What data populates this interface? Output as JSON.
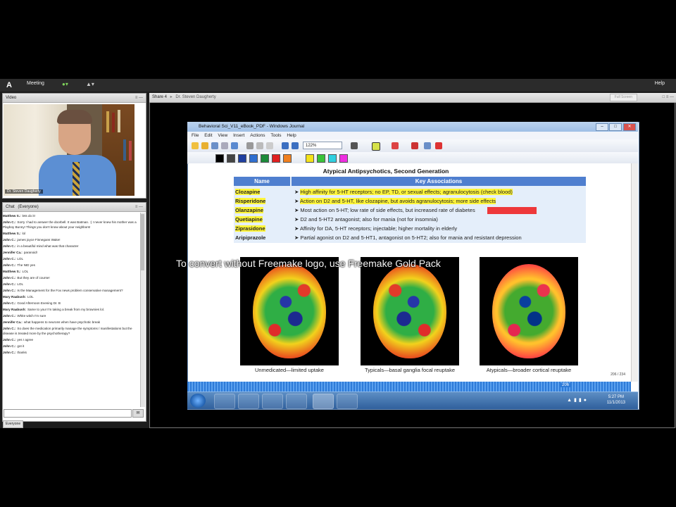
{
  "app": {
    "menu_meeting": "Meeting",
    "help": "Help"
  },
  "video_pod": {
    "title": "Video",
    "presenter_label": "Dr. Steven Daugherty"
  },
  "chat_pod": {
    "title": "Chat",
    "audience": "(Everyone)",
    "tab": "Everyone",
    "messages": [
      {
        "who": "Matthew S.:",
        "text": "lets do it!"
      },
      {
        "who": "John C.:",
        "text": "Sorry I had to answer the doorbell. It was Batman. :( I never knew his mother was a Playboy Bunny! Things you don't know about your neighbors!"
      },
      {
        "who": "Matthew S.:",
        "text": "lol"
      },
      {
        "who": "John C.:",
        "text": "james joyce Finnegans Wake!"
      },
      {
        "who": "John C.:",
        "text": "in a beautiful mind what was that character"
      },
      {
        "who": "Jennifer Ca.:",
        "text": "paranoid!"
      },
      {
        "who": "John C.:",
        "text": "LOL"
      },
      {
        "who": "John C.:",
        "text": "The NID yes"
      },
      {
        "who": "Matthew S.:",
        "text": "LOL"
      },
      {
        "who": "John C.:",
        "text": "But they are of course!"
      },
      {
        "who": "John C.:",
        "text": "LOL"
      },
      {
        "who": "John C.:",
        "text": "Is the Management for the Fox news problem conservative management?"
      },
      {
        "who": "Mary Raabush:",
        "text": "LOL"
      },
      {
        "who": "John C.:",
        "text": "Good Afternoon Evening Dr. B"
      },
      {
        "who": "Mary Raabush:",
        "text": "Same to you! I'm taking a break from my brownies lol."
      },
      {
        "who": "John C.:",
        "text": "White witch I'm sure"
      },
      {
        "who": "Jennifer Ca.:",
        "text": "what happens to neurons when have psychotic break"
      },
      {
        "who": "John C.:",
        "text": "So does the medication primarily manage the symptoms / manifestations but the disease is treated more by the psychotherapy?"
      },
      {
        "who": "John C.:",
        "text": "yes I agree"
      },
      {
        "who": "John C.:",
        "text": "got it"
      },
      {
        "who": "John C.:",
        "text": "thanks"
      }
    ]
  },
  "share_pod": {
    "title": "Share 4",
    "presenter": "Dr. Steven Daugherty",
    "fullscreen": "Full Screen"
  },
  "journal": {
    "window_title": "Behavioral Sci_V11_eBook_PDF - Windows Journal",
    "menus": [
      "File",
      "Edit",
      "View",
      "Insert",
      "Actions",
      "Tools",
      "Help"
    ],
    "zoom": "122%",
    "page_indicator": "206 / 234",
    "hscroll_page": "206"
  },
  "slide": {
    "title": "Atypical Antipsychotics, Second Generation",
    "col_name": "Name",
    "col_key": "Key Associations",
    "rows": [
      {
        "name": "Clozapine",
        "key": "High affinity for 5-HT receptors; no EP, TD, or sexual effects; agranulocytosis (check blood)"
      },
      {
        "name": "Risperidone",
        "key": "Action on D2 and 5-HT, like clozapine, but avoids agranulocytosis; more side effects"
      },
      {
        "name": "Olanzapine",
        "key": "Most action on 5-HT; low rate of side effects, but increased rate of diabetes"
      },
      {
        "name": "Quetiapine",
        "key": "D2 and 5-HT2 antagonist; also for mania (not for insomnia)"
      },
      {
        "name": "Ziprasidone",
        "key": "Affinity for DA, 5-HT receptors; injectable; higher mortality in elderly"
      },
      {
        "name": "Aripiprazole",
        "key": "Partial agonist on D2 and 5-HT1, antagonist on 5-HT2; also for mania and resistant depression"
      }
    ],
    "captions": [
      "Unmedicated—limited uptake",
      "Typicals—basal ganglia focal reuptake",
      "Atypicals—broader cortical reuptake"
    ],
    "watermark": "To convert without Freemake logo, use Freemake Gold Pack"
  },
  "taskbar": {
    "time": "5:27 PM",
    "date": "11/1/2013"
  },
  "colors": {
    "highlight": "#fff53a",
    "red_highlight": "#f01818",
    "table_header": "#4f7fcf"
  }
}
